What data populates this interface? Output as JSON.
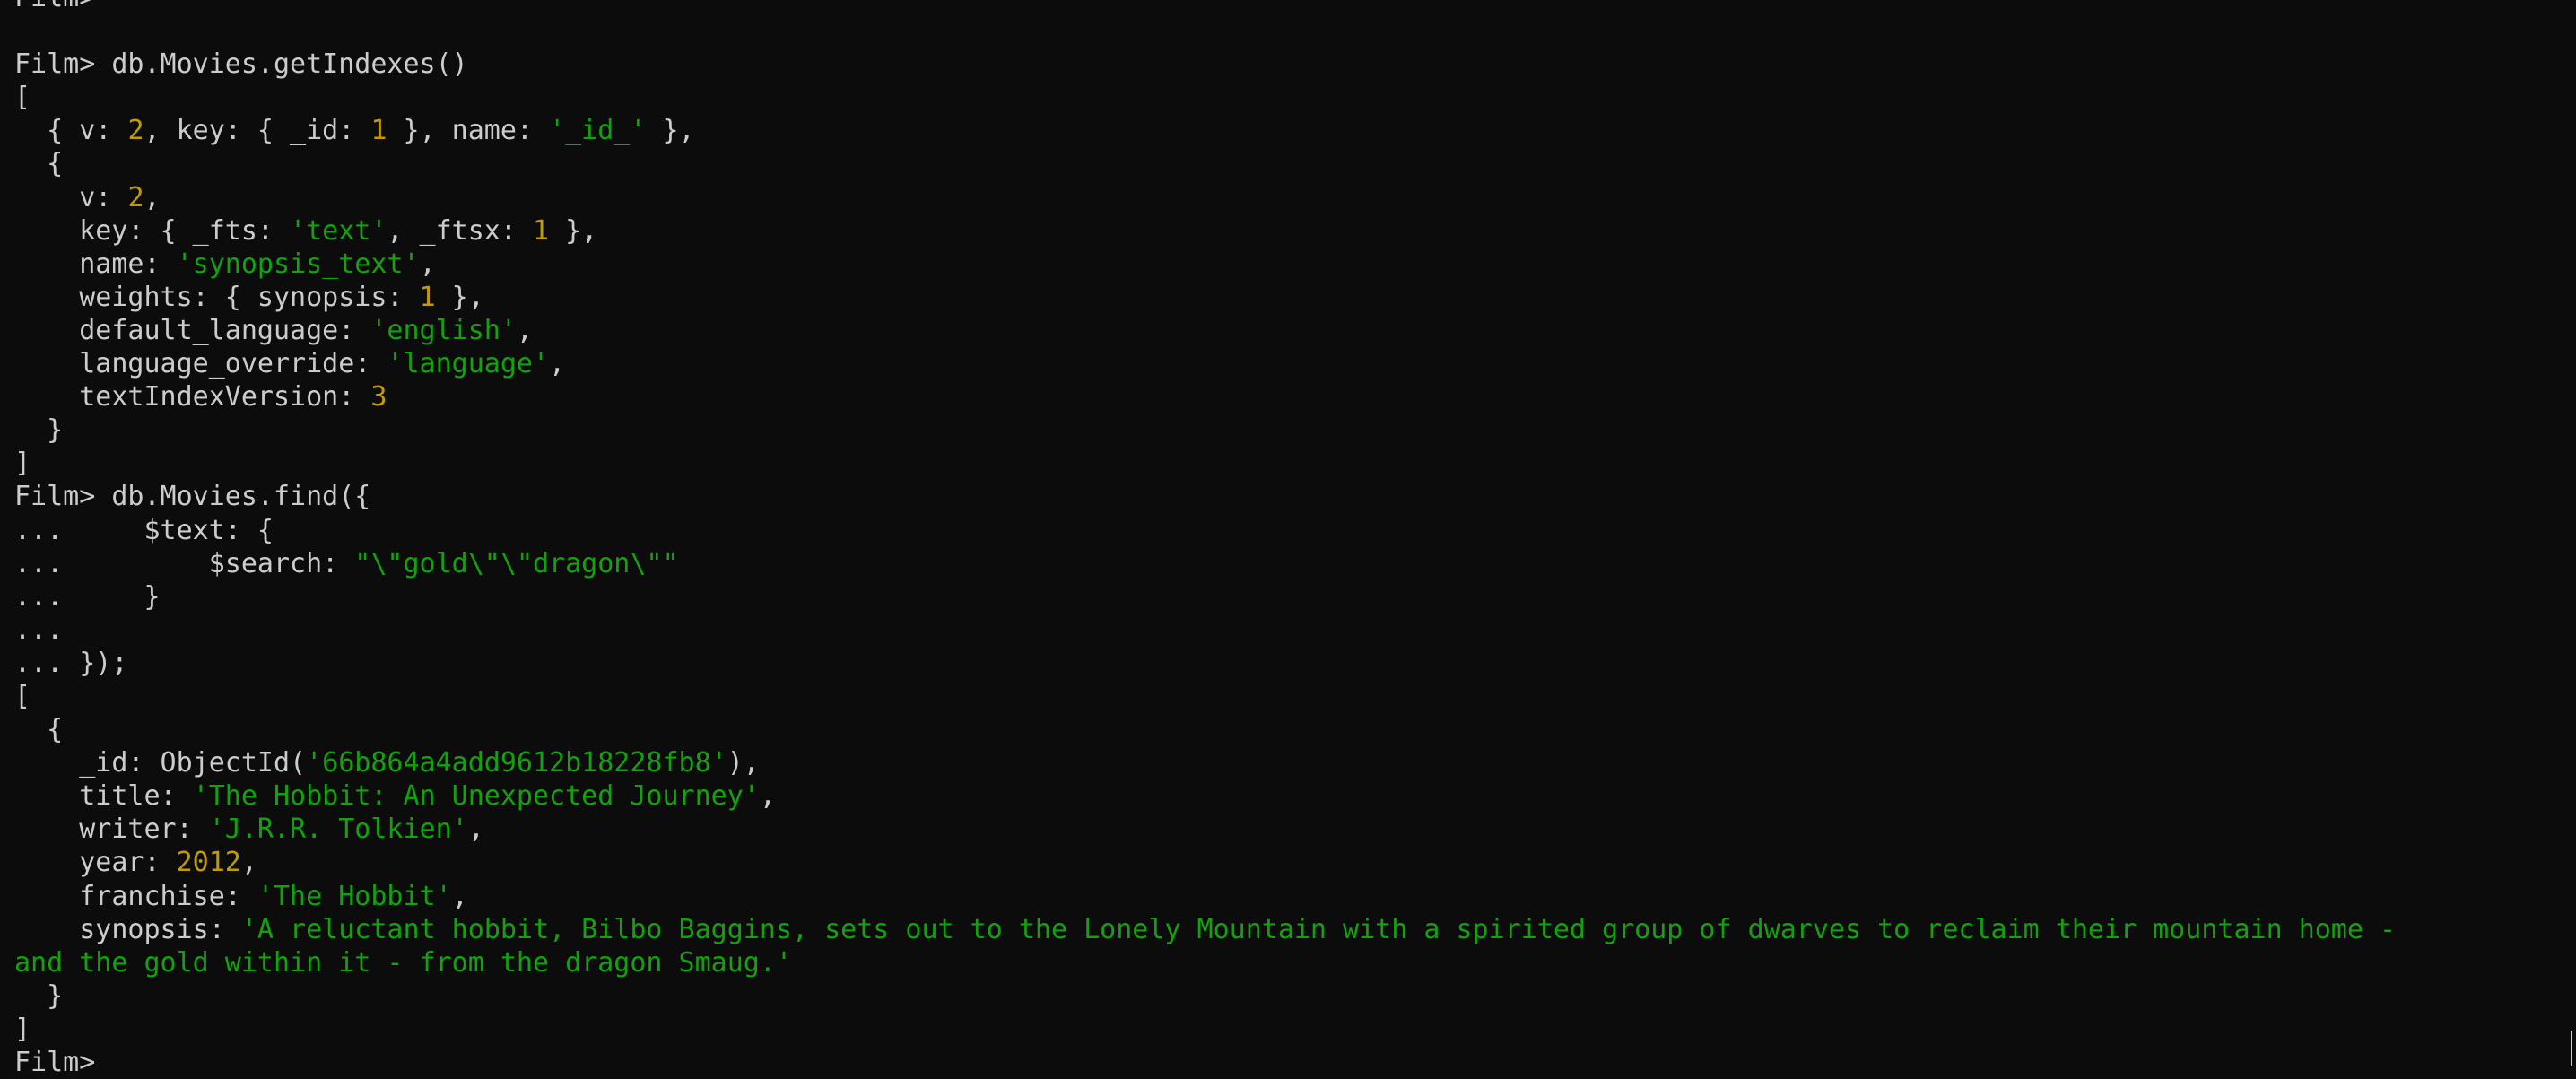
{
  "terminal": {
    "lines": [
      [
        {
          "t": "Film>",
          "c": "t"
        }
      ],
      [],
      [
        {
          "t": "Film> db.Movies.getIndexes()",
          "c": "t"
        }
      ],
      [
        {
          "t": "[",
          "c": "t"
        }
      ],
      [
        {
          "t": "  { v: ",
          "c": "t"
        },
        {
          "t": "2",
          "c": "n"
        },
        {
          "t": ", key: { _id: ",
          "c": "t"
        },
        {
          "t": "1",
          "c": "n"
        },
        {
          "t": " }, name: ",
          "c": "t"
        },
        {
          "t": "'_id_'",
          "c": "s"
        },
        {
          "t": " },",
          "c": "t"
        }
      ],
      [
        {
          "t": "  {",
          "c": "t"
        }
      ],
      [
        {
          "t": "    v: ",
          "c": "t"
        },
        {
          "t": "2",
          "c": "n"
        },
        {
          "t": ",",
          "c": "t"
        }
      ],
      [
        {
          "t": "    key: { _fts: ",
          "c": "t"
        },
        {
          "t": "'text'",
          "c": "s"
        },
        {
          "t": ", _ftsx: ",
          "c": "t"
        },
        {
          "t": "1",
          "c": "n"
        },
        {
          "t": " },",
          "c": "t"
        }
      ],
      [
        {
          "t": "    name: ",
          "c": "t"
        },
        {
          "t": "'synopsis_text'",
          "c": "s"
        },
        {
          "t": ",",
          "c": "t"
        }
      ],
      [
        {
          "t": "    weights: { synopsis: ",
          "c": "t"
        },
        {
          "t": "1",
          "c": "n"
        },
        {
          "t": " },",
          "c": "t"
        }
      ],
      [
        {
          "t": "    default_language: ",
          "c": "t"
        },
        {
          "t": "'english'",
          "c": "s"
        },
        {
          "t": ",",
          "c": "t"
        }
      ],
      [
        {
          "t": "    language_override: ",
          "c": "t"
        },
        {
          "t": "'language'",
          "c": "s"
        },
        {
          "t": ",",
          "c": "t"
        }
      ],
      [
        {
          "t": "    textIndexVersion: ",
          "c": "t"
        },
        {
          "t": "3",
          "c": "n"
        }
      ],
      [
        {
          "t": "  }",
          "c": "t"
        }
      ],
      [
        {
          "t": "]",
          "c": "t"
        }
      ],
      [
        {
          "t": "Film> db.Movies.find({",
          "c": "t"
        }
      ],
      [
        {
          "t": "...     $text: {",
          "c": "t"
        }
      ],
      [
        {
          "t": "...         $search: ",
          "c": "t"
        },
        {
          "t": "\"\\\"gold\\\"\\\"dragon\\\"\"",
          "c": "s"
        }
      ],
      [
        {
          "t": "...     }",
          "c": "t"
        }
      ],
      [
        {
          "t": "...",
          "c": "t"
        }
      ],
      [
        {
          "t": "... });",
          "c": "t"
        }
      ],
      [
        {
          "t": "[",
          "c": "t"
        }
      ],
      [
        {
          "t": "  {",
          "c": "t"
        }
      ],
      [
        {
          "t": "    _id: ObjectId(",
          "c": "t"
        },
        {
          "t": "'66b864a4add9612b18228fb8'",
          "c": "s"
        },
        {
          "t": "),",
          "c": "t"
        }
      ],
      [
        {
          "t": "    title: ",
          "c": "t"
        },
        {
          "t": "'The Hobbit: An Unexpected Journey'",
          "c": "s"
        },
        {
          "t": ",",
          "c": "t"
        }
      ],
      [
        {
          "t": "    writer: ",
          "c": "t"
        },
        {
          "t": "'J.R.R. Tolkien'",
          "c": "s"
        },
        {
          "t": ",",
          "c": "t"
        }
      ],
      [
        {
          "t": "    year: ",
          "c": "t"
        },
        {
          "t": "2012",
          "c": "n"
        },
        {
          "t": ",",
          "c": "t"
        }
      ],
      [
        {
          "t": "    franchise: ",
          "c": "t"
        },
        {
          "t": "'The Hobbit'",
          "c": "s"
        },
        {
          "t": ",",
          "c": "t"
        }
      ],
      [
        {
          "t": "    synopsis: ",
          "c": "t"
        },
        {
          "t": "'A reluctant hobbit, Bilbo Baggins, sets out to the Lonely Mountain with a spirited group of dwarves to reclaim their mountain home -",
          "c": "s"
        }
      ],
      [
        {
          "t": "and the gold within it - from the dragon Smaug.'",
          "c": "s"
        }
      ],
      [
        {
          "t": "  }",
          "c": "t"
        }
      ],
      [
        {
          "t": "]",
          "c": "t"
        }
      ],
      [
        {
          "t": "Film> ",
          "c": "t"
        }
      ]
    ]
  },
  "colors": {
    "background": "#0c0c0c",
    "text": "#cccccc",
    "number": "#c19c00",
    "string": "#13a10e"
  }
}
